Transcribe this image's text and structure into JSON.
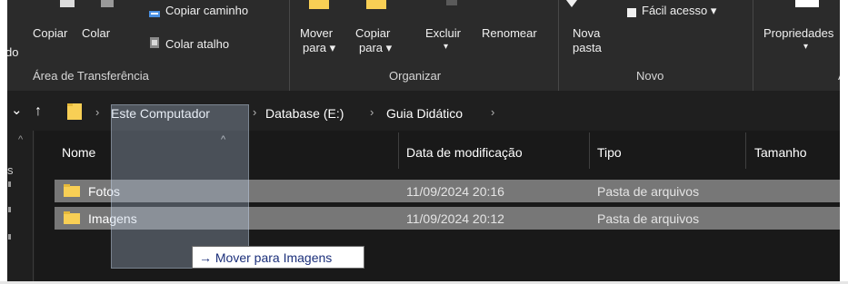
{
  "ribbon": {
    "cut_label_fragment": "do",
    "copy_label": "Copiar",
    "paste_label": "Colar",
    "copy_path_label": "Copiar caminho",
    "paste_shortcut_label": "Colar atalho",
    "clipboard_group": "Área de Transferência",
    "move_to_label_1": "Mover",
    "move_to_label_2": "para ▾",
    "copy_to_label_1": "Copiar",
    "copy_to_label_2": "para ▾",
    "delete_label": "Excluir",
    "delete_arrow": "▾",
    "rename_label": "Renomear",
    "organize_group": "Organizar",
    "new_folder_label_1": "Nova",
    "new_folder_label_2": "pasta",
    "easy_access_label": "Fácil acesso ▾",
    "new_group": "Novo",
    "properties_label": "Propriedades",
    "properties_arrow": "▾",
    "open_group_fragment": "A"
  },
  "addressbar": {
    "back_label": "⌄",
    "up_label": "↑",
    "crumbs": [
      "Este Computador",
      "Database (E:)",
      "Guia Didático"
    ]
  },
  "columns": {
    "name": "Nome",
    "date": "Data de modificação",
    "type": "Tipo",
    "size": "Tamanho",
    "sort_indicator": "^"
  },
  "files": [
    {
      "name": "Fotos",
      "date": "11/09/2024 20:16",
      "type": "Pasta de arquivos"
    },
    {
      "name": "Imagens",
      "date": "11/09/2024 20:12",
      "type": "Pasta de arquivos"
    }
  ],
  "drag": {
    "tooltip": "→ Mover para Imagens"
  },
  "colors": {
    "ribbon_bg": "#2b2b2b",
    "content_bg": "#191919",
    "selected_row": "#777777",
    "folder_yellow": "#f8cf55",
    "tooltip_text": "#1b2f7a"
  }
}
